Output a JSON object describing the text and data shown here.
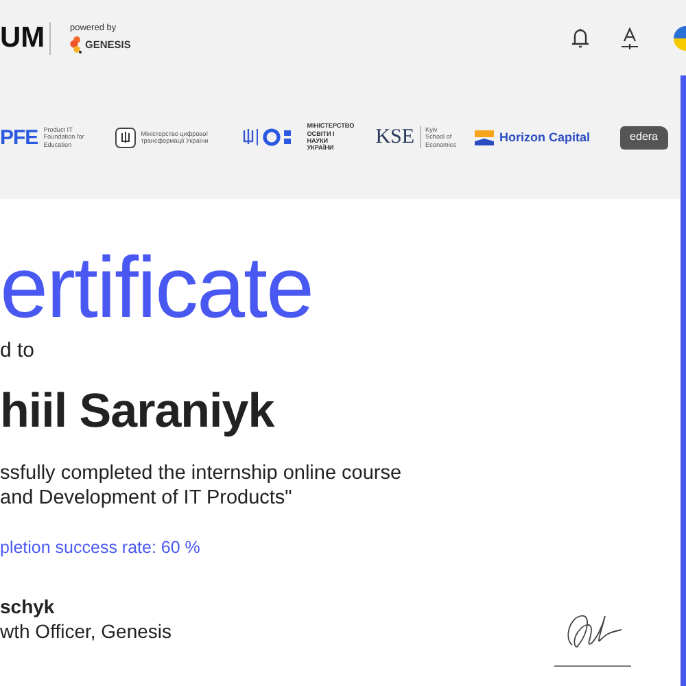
{
  "header": {
    "logo_text": "UM",
    "powered_by": "powered by",
    "partner_name": "GENESIS"
  },
  "partners": [
    {
      "kind": "pfe",
      "name": "PFE",
      "caption": "Product IT Foundation for Education"
    },
    {
      "kind": "emblem",
      "caption": "Міністерство цифрової трансформації України"
    },
    {
      "kind": "mon",
      "caption": "МІНІСТЕРСТВО ОСВІТИ І НАУКИ УКРАЇНИ"
    },
    {
      "kind": "kse",
      "name": "KSE",
      "caption": "Kyiv School of Economics"
    },
    {
      "kind": "horizon",
      "name": "Horizon Capital"
    },
    {
      "kind": "edera",
      "name": "edera"
    }
  ],
  "certificate": {
    "title": "ertificate",
    "awarded_to": "d to",
    "recipient": "hiil Saraniyk",
    "body_lines": [
      "ssfully completed the internship online course",
      "and Development of IT Products\""
    ],
    "success_rate": "pletion success rate: 60 %",
    "signer_name": "schyk",
    "signer_role": "wth Officer, Genesis"
  }
}
